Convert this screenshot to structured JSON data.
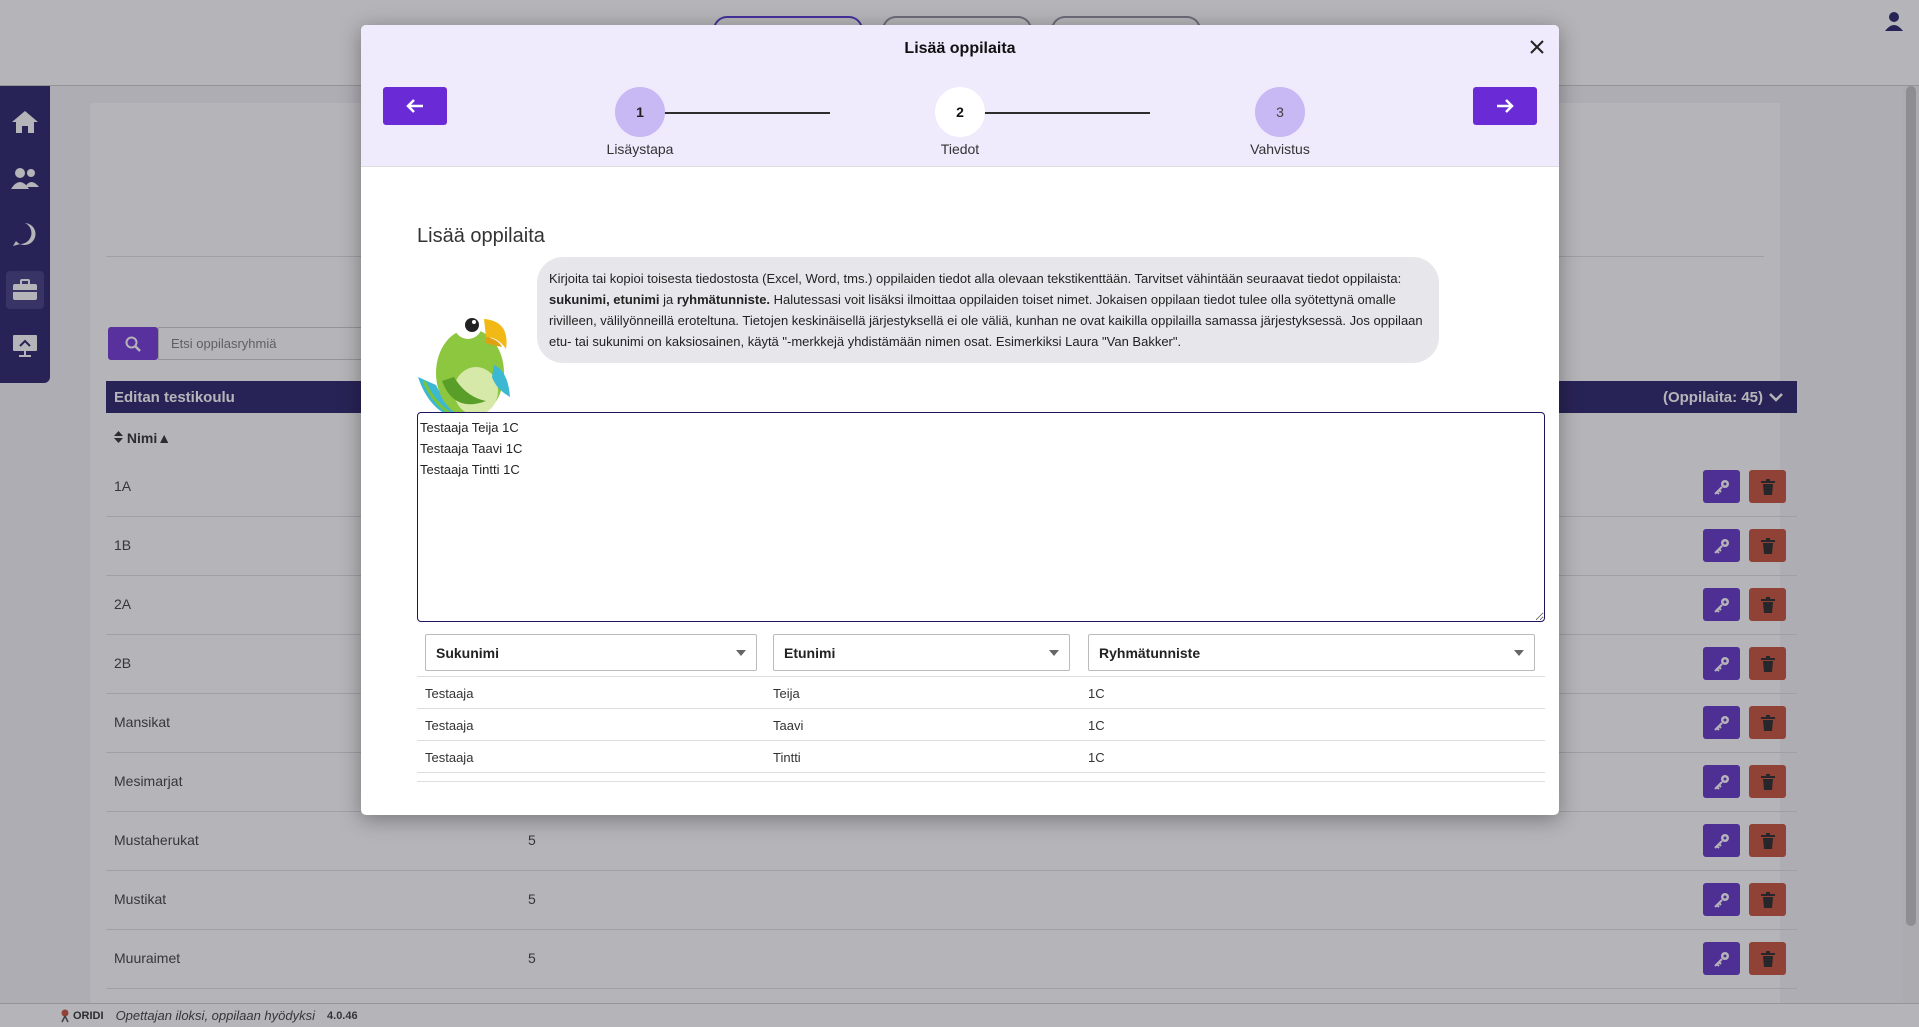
{
  "background": {
    "search_placeholder": "Etsi oppilasryhmiä",
    "school": {
      "name": "Editan testikoulu",
      "count_label": "(Oppilaita: 45)"
    },
    "sort_header": "Nimi▲",
    "groups": [
      {
        "name": "1A",
        "count": ""
      },
      {
        "name": "1B",
        "count": ""
      },
      {
        "name": "2A",
        "count": ""
      },
      {
        "name": "2B",
        "count": ""
      },
      {
        "name": "Mansikat",
        "count": ""
      },
      {
        "name": "Mesimarjat",
        "count": ""
      },
      {
        "name": "Mustaherukat",
        "count": "5"
      },
      {
        "name": "Mustikat",
        "count": "5"
      },
      {
        "name": "Muuraimet",
        "count": "5"
      }
    ],
    "footer": {
      "logo": "ORIDI",
      "tagline": "Opettajan iloksi, oppilaan hyödyksi",
      "version": "4.0.46"
    }
  },
  "modal": {
    "title": "Lisää oppilaita",
    "steps": [
      {
        "number": "1",
        "label": "Lisäystapa"
      },
      {
        "number": "2",
        "label": "Tiedot"
      },
      {
        "number": "3",
        "label": "Vahvistus"
      }
    ],
    "section_title": "Lisää oppilaita",
    "instructions": {
      "part1": "Kirjoita tai kopioi toisesta tiedostosta (Excel, Word, tms.) oppilaiden tiedot alla olevaan tekstikenttään. Tarvitset vähintään seuraavat tiedot oppilaista: ",
      "bold1": "sukunimi, etunimi",
      "part2": " ja ",
      "bold2": "ryhmätunniste.",
      "part3": " Halutessasi voit lisäksi ilmoittaa oppilaiden toiset nimet. Jokaisen oppilaan tiedot tulee olla syötettynä omalle rivilleen, välilyönneillä eroteltuna. Tietojen keskinäisellä järjestyksellä ei ole väliä, kunhan ne ovat kaikilla oppilailla samassa järjestyksessä. Jos oppilaan etu- tai sukunimi on kaksiosainen, käytä \"-merkkejä yhdistämään nimen osat. Esimerkiksi Laura \"Van Bakker\"."
    },
    "textarea_value": "Testaaja Teija 1C\nTestaaja Taavi 1C\nTestaaja Tintti 1C",
    "columns": [
      "Sukunimi",
      "Etunimi",
      "Ryhmätunniste"
    ],
    "rows": [
      [
        "Testaaja",
        "Teija",
        "1C"
      ],
      [
        "Testaaja",
        "Taavi",
        "1C"
      ],
      [
        "Testaaja",
        "Tintti",
        "1C"
      ]
    ]
  },
  "colors": {
    "accent": "#6a2bd6",
    "navy": "#1c1460",
    "danger": "#c2462a",
    "header_bg": "#efeafc",
    "step_circle": "#c8b8f3"
  }
}
